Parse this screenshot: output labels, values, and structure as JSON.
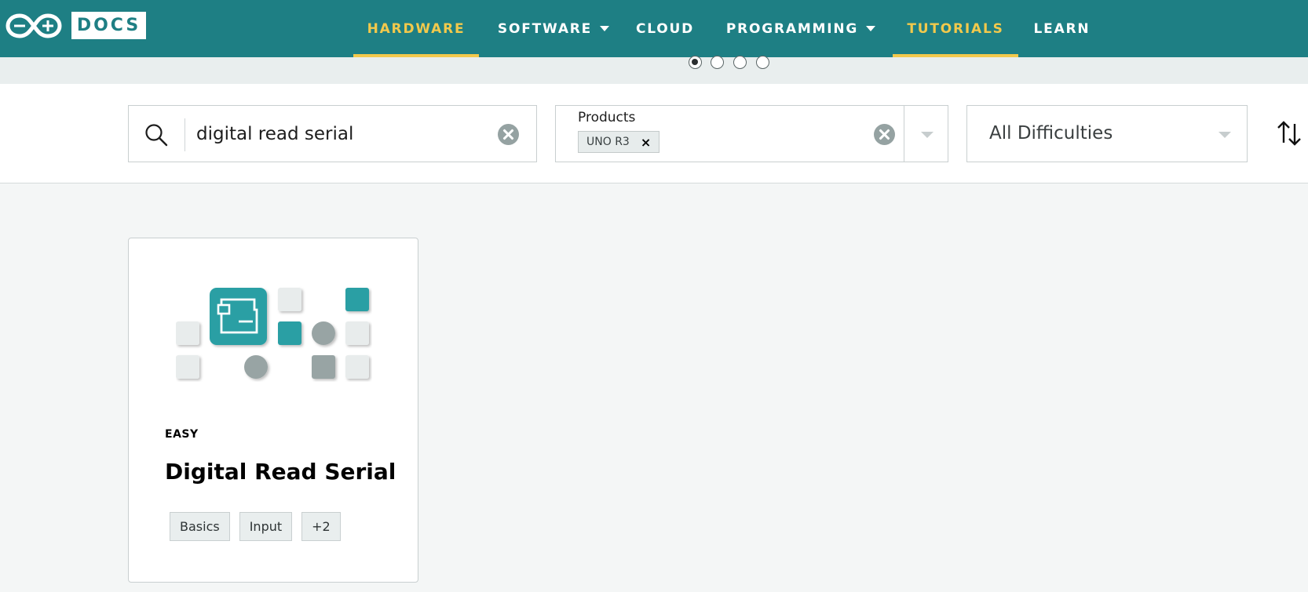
{
  "header": {
    "logo_icon": "arduino-infinity-logo-icon",
    "docs_label": "DOCS",
    "nav": [
      {
        "label": "HARDWARE",
        "active": true,
        "dropdown": false
      },
      {
        "label": "SOFTWARE",
        "active": false,
        "dropdown": true
      },
      {
        "label": "CLOUD",
        "active": false,
        "dropdown": false
      },
      {
        "label": "PROGRAMMING",
        "active": false,
        "dropdown": true
      },
      {
        "label": "TUTORIALS",
        "active": true,
        "dropdown": false
      },
      {
        "label": "LEARN",
        "active": false,
        "dropdown": false
      }
    ],
    "accent_color": "#f2c94c",
    "bar_color": "#1e7f84"
  },
  "carousel": {
    "slide_count": 4,
    "active_index": 0
  },
  "filters": {
    "search": {
      "value": "digital read serial",
      "icon": "search-icon"
    },
    "products": {
      "label": "Products",
      "chips": [
        "UNO R3"
      ]
    },
    "difficulty": {
      "value": "All Difficulties"
    },
    "sort_icon": "sort-arrows-icon"
  },
  "results": [
    {
      "level": "EASY",
      "title": "Digital Read Serial",
      "tags": [
        "Basics",
        "Input",
        "+2"
      ]
    }
  ]
}
